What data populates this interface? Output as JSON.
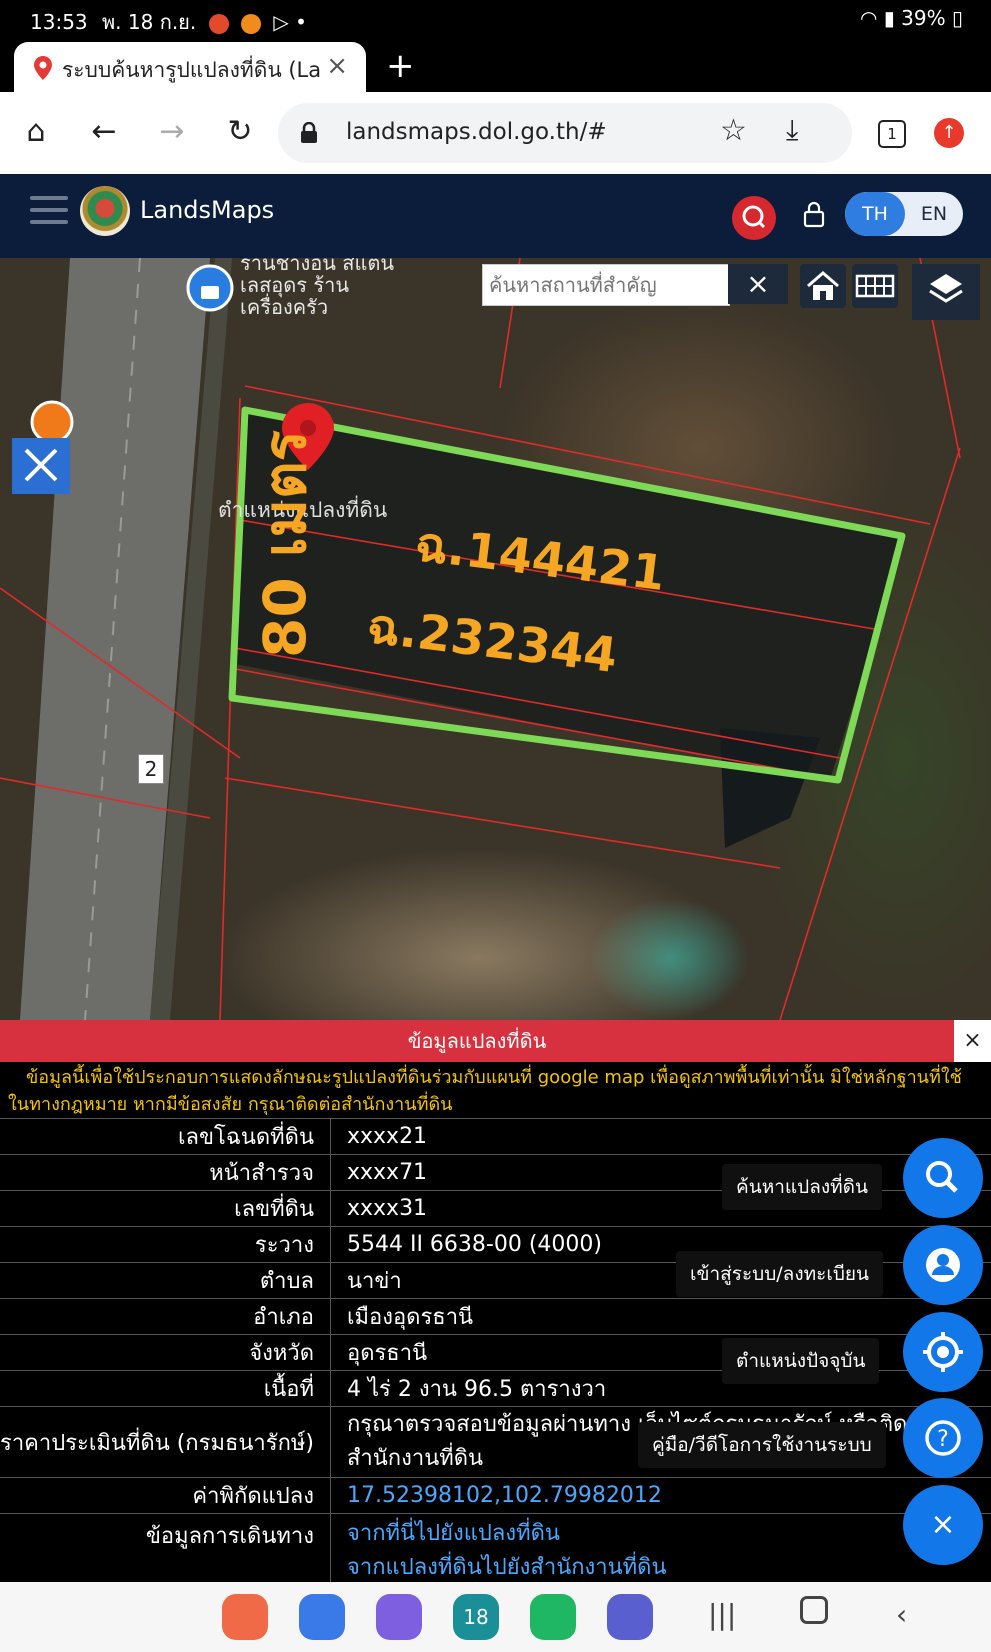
{
  "status_bar": {
    "time": "13:53",
    "date": "พ. 18 ก.ย.",
    "battery": "39%"
  },
  "browser": {
    "tab_title": "ระบบค้นหารูปแปลงที่ดิน (La",
    "new_tab": "+",
    "url": "landsmaps.dol.go.th/#",
    "tab_count": "1"
  },
  "app": {
    "brand": "LandsMaps",
    "lang_th": "TH",
    "lang_en": "EN"
  },
  "map": {
    "search_placeholder": "ค้นหาสถานที่สำคัญ",
    "clear": "×",
    "shop_label": "ร้านช่างอัน สแตนเลสอุดร ร้านเครื่องครัว",
    "parcel_position": "ตำแหน่งแปลงที่ดิน",
    "parcel_1": "ฉ.144421",
    "parcel_2": "ฉ.232344",
    "width_label": "80 เมตร",
    "road_number": "2"
  },
  "panel": {
    "title": "ข้อมูลแปลงที่ดิน",
    "close": "×",
    "disclaimer": "ข้อมูลนี้เพื่อใช้ประกอบการแสดงลักษณะรูปแปลงที่ดินร่วมกับแผนที่ google map เพื่อดูสภาพพื้นที่เท่านั้น มิใช่หลักฐานที่ใช้ในทางกฎหมาย หากมีข้อสงสัย กรุณาติดต่อสำนักงานที่ดิน",
    "rows": [
      {
        "key": "เลขโฉนดที่ดิน",
        "value": "xxxx21"
      },
      {
        "key": "หน้าสำรวจ",
        "value": "xxxx71"
      },
      {
        "key": "เลขที่ดิน",
        "value": "xxxx31"
      },
      {
        "key": "ระวาง",
        "value": "5544 II 6638-00 (4000)"
      },
      {
        "key": "ตำบล",
        "value": "นาข่า"
      },
      {
        "key": "อำเภอ",
        "value": "เมืองอุดรธานี"
      },
      {
        "key": "จังหวัด",
        "value": "อุดรธานี"
      },
      {
        "key": "เนื้อที่",
        "value": "4 ไร่ 2 งาน 96.5 ตารางวา"
      }
    ],
    "appraisal_key": "ราคาประเมินที่ดิน (กรมธนารักษ์)",
    "appraisal_value_1": "กรุณาตรวจสอบข้อมูลผ่านทาง เว็บไซต์กรมธนารักษ์ หรือติดต่อ",
    "appraisal_value_2": "สำนักงานที่ดิน",
    "coords_key": "ค่าพิกัดแปลง",
    "coords_value": "17.52398102,102.79982012",
    "travel_key": "ข้อมูลการเดินทาง",
    "travel_link_1": "จากที่นี่ไปยังแปลงที่ดิน",
    "travel_link_2": "จากแปลงที่ดินไปยังสำนักงานที่ดิน"
  },
  "fab": {
    "search_parcel": "ค้นหาแปลงที่ดิน",
    "login": "เข้าสู่ระบบ/ลงทะเบียน",
    "current_location": "ตำแหน่งปัจจุบัน",
    "manual": "คู่มือ/วีดีโอการใช้งานระบบ",
    "close": "×"
  },
  "nav_bar": {
    "calendar_day": "18"
  },
  "colors": {
    "header_navy": "#0b1d3a",
    "accent_blue": "#1277e8",
    "panel_red": "#d7313f",
    "parcel_green": "#7ed957",
    "label_orange": "#f5a623",
    "disclaimer_yellow": "#f5c400"
  }
}
